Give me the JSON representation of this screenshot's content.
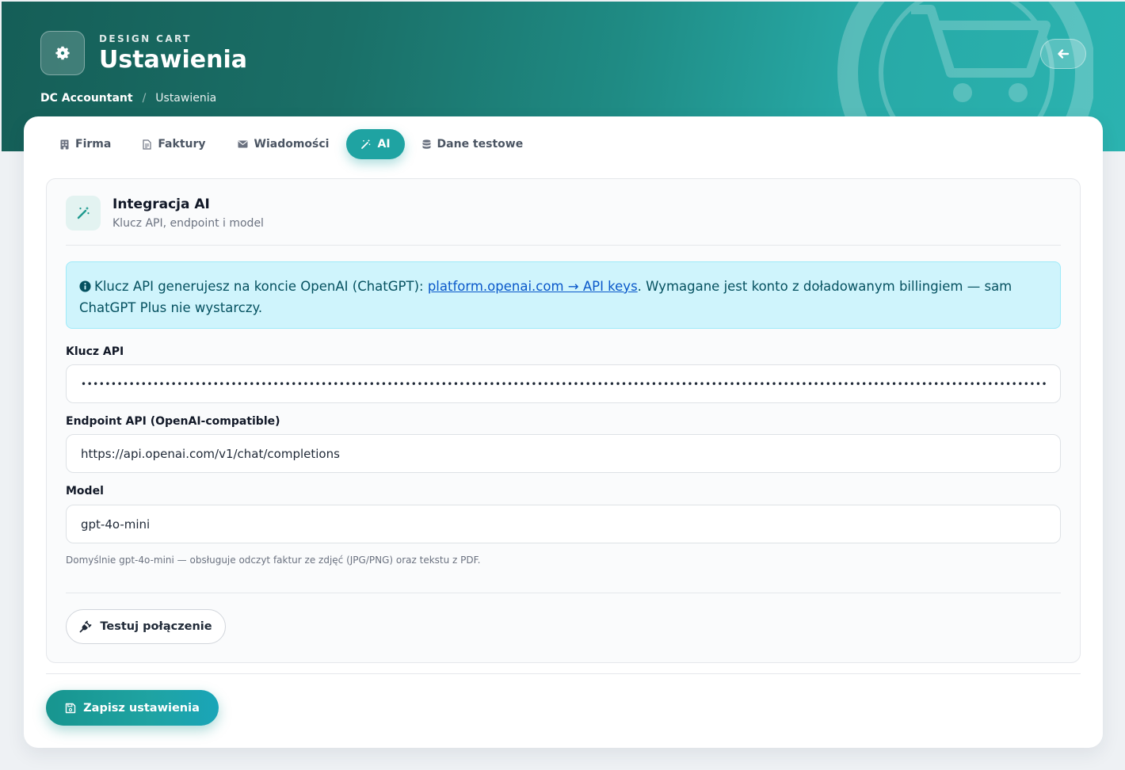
{
  "header": {
    "eyebrow": "DESIGN CART",
    "title": "Ustawienia",
    "breadcrumb": {
      "root": "DC Accountant",
      "separator": "/",
      "current": "Ustawienia"
    },
    "brand_icon": "gear-icon",
    "back_icon": "arrow-left-icon"
  },
  "tabs": [
    {
      "label": "Firma",
      "icon": "building-icon",
      "active": false
    },
    {
      "label": "Faktury",
      "icon": "document-icon",
      "active": false
    },
    {
      "label": "Wiadomości",
      "icon": "envelope-icon",
      "active": false
    },
    {
      "label": "AI",
      "icon": "magic-wand-icon",
      "active": true
    },
    {
      "label": "Dane testowe",
      "icon": "database-icon",
      "active": false
    }
  ],
  "panel": {
    "title": "Integracja AI",
    "subtitle": "Klucz API, endpoint i model",
    "info": {
      "text_before": "Klucz API generujesz na koncie OpenAI (ChatGPT): ",
      "link_text": "platform.openai.com → API keys",
      "text_after": ". Wymagane jest konto z doładowanym billingiem — sam ChatGPT Plus nie wystarczy."
    },
    "api_key": {
      "label": "Klucz API",
      "value": "••••••••••••••••••••••••••••••••••••••••••••••••••••••••••••••••••••••••••••••••••••••••••••••••••••••••••••••••••••••••••••••••••••••••••••••••••••••••••••••••••••••••"
    },
    "endpoint": {
      "label": "Endpoint API (OpenAI-compatible)",
      "value": "https://api.openai.com/v1/chat/completions"
    },
    "model": {
      "label": "Model",
      "value": "gpt-4o-mini",
      "help": "Domyślnie gpt-4o-mini — obsługuje odczyt faktur ze zdjęć (JPG/PNG) oraz tekstu z PDF."
    },
    "test_button": "Testuj połączenie"
  },
  "save_button": "Zapisz ustawienia",
  "colors": {
    "accent": "#1fa3a2",
    "hero_start": "#155e57",
    "hero_end": "#2bb3b0",
    "info_bg": "#cff4fc",
    "info_text": "#055160"
  }
}
